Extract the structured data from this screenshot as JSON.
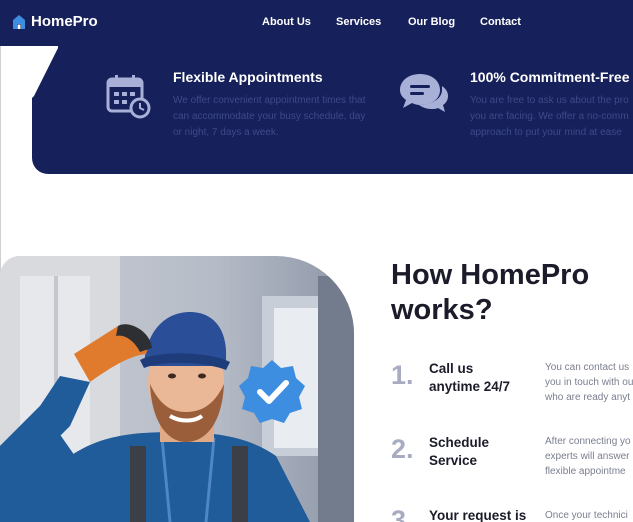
{
  "brand": {
    "name": "HomePro"
  },
  "nav": {
    "items": [
      {
        "label": "About Us"
      },
      {
        "label": "Services"
      },
      {
        "label": "Our Blog"
      },
      {
        "label": "Contact"
      }
    ]
  },
  "features": [
    {
      "title": "Flexible Appointments",
      "desc": [
        "We offer convenient appointment times that",
        "can accommodate your busy schedule, day",
        "or night, 7 days a week."
      ]
    },
    {
      "title": "100% Commitment-Free",
      "desc": [
        "You are free to ask us about the pro",
        "you are facing. We offer a no-comm",
        "approach to put your mind at ease"
      ]
    }
  ],
  "how": {
    "title_line1": "How HomePro",
    "title_line2": "works?"
  },
  "steps": [
    {
      "num": "1.",
      "title_line1": "Call us",
      "title_line2": "anytime 24/7",
      "desc": [
        "You can contact us",
        "you in touch with ou",
        "who are ready anyt"
      ]
    },
    {
      "num": "2.",
      "title_line1": "Schedule",
      "title_line2": "Service",
      "desc": [
        "After connecting yo",
        "experts will answer",
        "flexible appointme"
      ]
    },
    {
      "num": "3.",
      "title_line1": "Your request is",
      "title_line2": "",
      "desc": [
        "Once your technici"
      ]
    }
  ],
  "colors": {
    "navy": "#16205a",
    "badge": "#3d8de0"
  }
}
